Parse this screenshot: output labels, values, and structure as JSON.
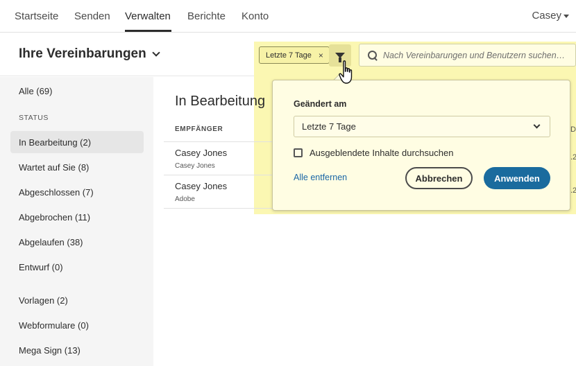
{
  "topnav": {
    "tabs": [
      "Startseite",
      "Senden",
      "Verwalten",
      "Berichte",
      "Konto"
    ],
    "active_tab": "Verwalten",
    "user": "Casey"
  },
  "header": {
    "title": "Ihre Vereinbarungen",
    "filter_chip": "Letzte 7 Tage",
    "search_placeholder": "Nach Vereinbarungen und Benutzern suchen…"
  },
  "sidebar": {
    "all": "Alle (69)",
    "status_label": "STATUS",
    "items": [
      "In Bearbeitung (2)",
      "Wartet auf Sie (8)",
      "Abgeschlossen (7)",
      "Abgebrochen (11)",
      "Abgelaufen (38)",
      "Entwurf (0)"
    ],
    "selected": "In Bearbeitung (2)",
    "other_items": [
      "Vorlagen (2)",
      "Webformulare (0)",
      "Mega Sign (13)"
    ]
  },
  "main": {
    "title": "In Bearbeitung",
    "column_recipient": "EMPFÄNGER",
    "rows": [
      {
        "name": "Casey Jones",
        "sub": "Casey Jones"
      },
      {
        "name": "Casey Jones",
        "sub": "Adobe"
      }
    ],
    "edge_fragments": [
      "D",
      ".2",
      ".2"
    ]
  },
  "filter_panel": {
    "label": "Geändert am",
    "select_value": "Letzte 7 Tage",
    "checkbox_label": "Ausgeblendete Inhalte durchsuchen",
    "checkbox_checked": false,
    "remove_all": "Alle entfernen",
    "cancel": "Abbrechen",
    "apply": "Anwenden"
  },
  "colors": {
    "highlight": "#fbf7b2",
    "apply_button": "#1a6b9e",
    "link": "#1a66a6"
  },
  "icons": [
    "chevron-down-icon",
    "close-icon",
    "filter-icon",
    "search-icon",
    "hand-cursor-icon"
  ]
}
